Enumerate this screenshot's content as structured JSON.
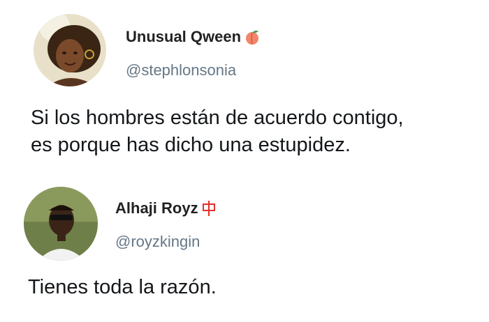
{
  "tweets": [
    {
      "display_name": "Unusual Qween",
      "name_emoji": "peach-icon",
      "handle": "@stephlonsonia",
      "text": "Si los hombres están de acuerdo contigo,\nes porque has dicho una estupidez.",
      "avatar": "profile-photo-woman"
    },
    {
      "display_name": "Alhaji Royz",
      "name_emoji": "chinese-character-icon",
      "handle": "@royzkingin",
      "text": "Tienes toda la razón.",
      "avatar": "profile-photo-man-sunglasses"
    }
  ],
  "colors": {
    "name": "#222222",
    "handle": "#657786",
    "text": "#14171a",
    "emoji_accent": "#e0312b"
  }
}
